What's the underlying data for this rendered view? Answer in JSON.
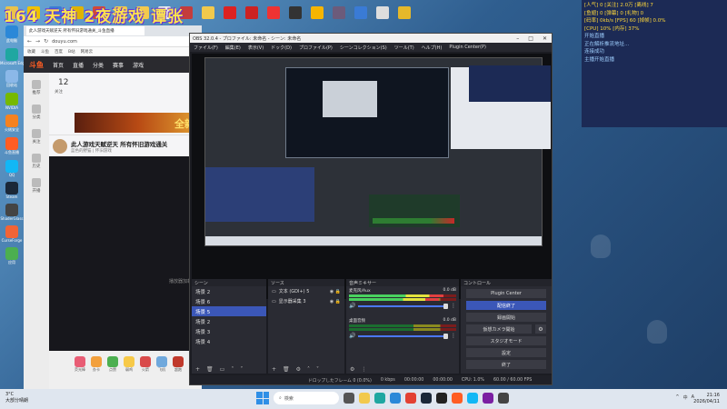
{
  "overlay": {
    "text": "164 天神 2夜游戏 谭张"
  },
  "stats": {
    "lines": [
      "[人气] 0 [关注] 2.0万 [离线] 7",
      "[鱼翅] 0 [弹幕] 0 [礼物] 0",
      "[码率] 0kb/s [FPS] 60 [掉帧] 0.0%",
      "[CPU] 10% [内存] 37%"
    ],
    "messages": [
      "开始直播",
      "正在解析推流地址...",
      "连接成功",
      "主播开始直播"
    ]
  },
  "desktop_left": [
    {
      "label": "此电脑",
      "color": "#2b88d8"
    },
    {
      "label": "Microsoft Edge",
      "color": "#1fa7a1"
    },
    {
      "label": "回收站",
      "color": "#8bb8e8"
    },
    {
      "label": "NVIDIA",
      "color": "#76b900"
    },
    {
      "label": "火绒安全",
      "color": "#f58220"
    },
    {
      "label": "斗鱼直播",
      "color": "#ff5d23"
    },
    {
      "label": "QQ",
      "color": "#12b7f5"
    },
    {
      "label": "Steam",
      "color": "#1b2838"
    },
    {
      "label": "ShaderGlass",
      "color": "#444"
    },
    {
      "label": "CurseForge",
      "color": "#f16436"
    },
    {
      "label": "应用",
      "color": "#4caf50"
    }
  ],
  "browser": {
    "tab": "此人游戏天赋逆天 所有怀旧游戏通关_斗鱼直播",
    "url": "douyu.com",
    "bookmarks": [
      "收藏",
      "斗鱼",
      "百度",
      "B站",
      "网易云"
    ],
    "nav": [
      "首页",
      "直播",
      "分类",
      "赛事",
      "游戏"
    ],
    "logo": "斗鱼",
    "count": "12",
    "count_label": "关注",
    "sidebar": [
      "推荐",
      "分类",
      "关注",
      "历史",
      "开播"
    ],
    "banner": "全新",
    "room_title": "此人游戏天赋逆天 所有怀旧游戏通关",
    "room_sub": "蓝色的野猫 | 怀旧游戏",
    "player_hint": "播放器加载中",
    "gifts": [
      "荧光棒",
      "办卡",
      "点赞",
      "弱鸡",
      "火箭",
      "飞机",
      "超跑",
      "大气"
    ]
  },
  "obs": {
    "title": "OBS 32.0.4 - プロファイル: 未命名 - シーン: 未命名",
    "menu": [
      "ファイル(F)",
      "編集(E)",
      "表示(V)",
      "ドック(D)",
      "プロファイル(P)",
      "シーンコレクション(S)",
      "ツール(T)",
      "ヘルプ(H)",
      "Plugin Center(P)"
    ],
    "scenes_title": "シーン",
    "scenes": [
      "场景 2",
      "场景 6",
      "场景 5",
      "场景 2",
      "场景 3",
      "场景 4"
    ],
    "sources_title": "ソース",
    "sources": [
      "文本 (GDI+) 5",
      "显示器采集 3"
    ],
    "mixer_title": "音声ミキサー",
    "mixer": [
      {
        "name": "麦克风/Aux",
        "db": "0.0 dB"
      },
      {
        "name": "桌面音频",
        "db": "0.0 dB"
      }
    ],
    "controls_title": "コントロール",
    "controls": {
      "plugin_center": "Plugin Center",
      "stop_stream": "配信終了",
      "start_record": "録画開始",
      "virtual_cam": "仮想カメラ開始",
      "studio": "スタジオモード",
      "settings": "設定",
      "exit": "終了"
    },
    "status": {
      "dropped": "ドロップしたフレーム 0 (0.0%)",
      "bitrate": "0 kbps",
      "live_time": "00:00:00",
      "rec_time": "00:00:00",
      "cpu": "CPU: 1.0%",
      "fps": "60.00 / 60.00 FPS"
    }
  },
  "taskbar": {
    "weather": "3°C",
    "weather_sub": "大部分晴朗",
    "search": "検索",
    "time": "21:16",
    "date": "2026/04/11",
    "tray": [
      "^",
      "中",
      "A"
    ]
  }
}
